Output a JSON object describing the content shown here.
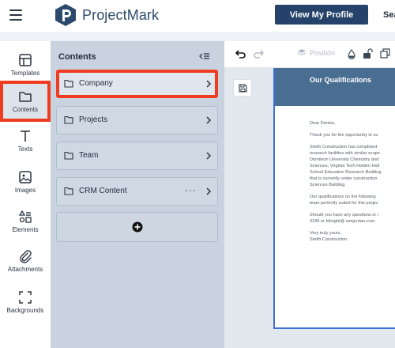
{
  "topbar": {
    "brand": "ProjectMark",
    "profile_button": "View My Profile",
    "search_partial": "Sea"
  },
  "rail": {
    "items": [
      {
        "label": "Templates",
        "icon": "templates-icon"
      },
      {
        "label": "Contents",
        "icon": "folder-icon",
        "active": true
      },
      {
        "label": "Texts",
        "icon": "text-icon"
      },
      {
        "label": "Images",
        "icon": "image-icon"
      },
      {
        "label": "Elements",
        "icon": "elements-icon"
      },
      {
        "label": "Attachments",
        "icon": "paperclip-icon"
      },
      {
        "label": "Backgrounds",
        "icon": "background-icon"
      }
    ]
  },
  "panel": {
    "title": "Contents",
    "folders": [
      {
        "label": "Company",
        "active": true
      },
      {
        "label": "Projects"
      },
      {
        "label": "Team"
      },
      {
        "label": "CRM Content",
        "more": "···"
      }
    ]
  },
  "editor": {
    "position_label": "Position",
    "doc": {
      "header": "Our Qualifications",
      "greeting": "Dear Denise,",
      "intro": "Thank you for the opportunity to su",
      "para1": [
        "Smith Construction has completed",
        "research facilities with similar scope",
        "Dominion University Chemistry and",
        "Sciences, Virginia Tech Holden Hall",
        "School Education Research Building",
        "that is currently under construction",
        "Sciences Building."
      ],
      "para2": [
        "Our qualifications on the following",
        "team perfectly suited for this projec"
      ],
      "para3": [
        "Should you have any questions or r",
        "3240 or bknight@ wmjordan.com."
      ],
      "closing": [
        "Very truly yours,",
        "Smith Construction"
      ]
    }
  },
  "colors": {
    "accent": "#25426a",
    "highlight": "#ef3b1f",
    "panel_bg": "#c9d3df",
    "doc_header": "#4a6d92"
  }
}
